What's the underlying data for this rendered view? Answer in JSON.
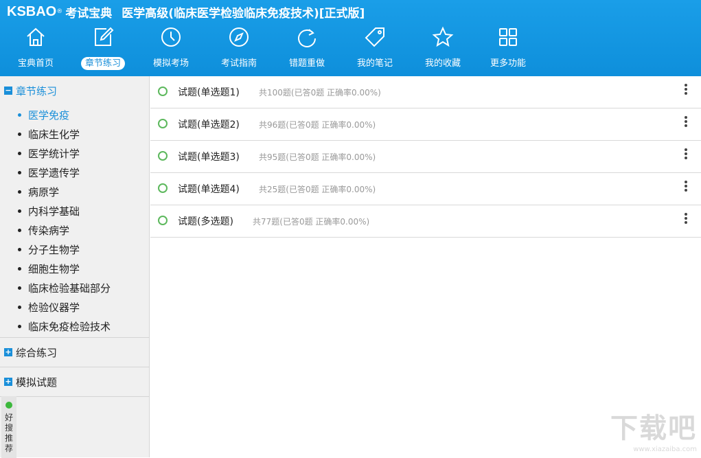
{
  "header": {
    "logo": "KSBAO",
    "logo_reg": "®",
    "logo_sub": "考试宝典",
    "title": "医学高级(临床医学检验临床免疫技术)[正式版]"
  },
  "nav": [
    {
      "label": "宝典首页",
      "icon": "home-icon"
    },
    {
      "label": "章节练习",
      "icon": "edit-icon"
    },
    {
      "label": "模拟考场",
      "icon": "clock-icon"
    },
    {
      "label": "考试指南",
      "icon": "compass-icon"
    },
    {
      "label": "错题重做",
      "icon": "refresh-icon"
    },
    {
      "label": "我的笔记",
      "icon": "tag-icon"
    },
    {
      "label": "我的收藏",
      "icon": "star-icon"
    },
    {
      "label": "更多功能",
      "icon": "grid-icon"
    }
  ],
  "sidebar": {
    "sections": [
      {
        "label": "章节练习",
        "toggle": "−"
      },
      {
        "label": "综合练习",
        "toggle": "+"
      },
      {
        "label": "模拟试题",
        "toggle": "+"
      }
    ],
    "chapters": [
      "医学免疫",
      "临床生化学",
      "医学统计学",
      "医学遗传学",
      "病原学",
      "内科学基础",
      "传染病学",
      "分子生物学",
      "细胞生物学",
      "临床检验基础部分",
      "检验仪器学",
      "临床免疫检验技术"
    ],
    "side_tab": "好搜推荐"
  },
  "rows": [
    {
      "title": "试题(单选题1)",
      "meta": "共100题(已答0题   正确率0.00%)"
    },
    {
      "title": "试题(单选题2)",
      "meta": "共96题(已答0题   正确率0.00%)"
    },
    {
      "title": "试题(单选题3)",
      "meta": "共95题(已答0题   正确率0.00%)"
    },
    {
      "title": "试题(单选题4)",
      "meta": "共25题(已答0题   正确率0.00%)"
    },
    {
      "title": "试题(多选题)",
      "meta": "共77题(已答0题   正确率0.00%)"
    }
  ],
  "watermark": {
    "text": "下载吧",
    "url": "www.xiazaiba.com"
  },
  "colors": {
    "accent": "#1a8fd9",
    "header": "#0e8fdb",
    "check": "#5cb85c"
  }
}
